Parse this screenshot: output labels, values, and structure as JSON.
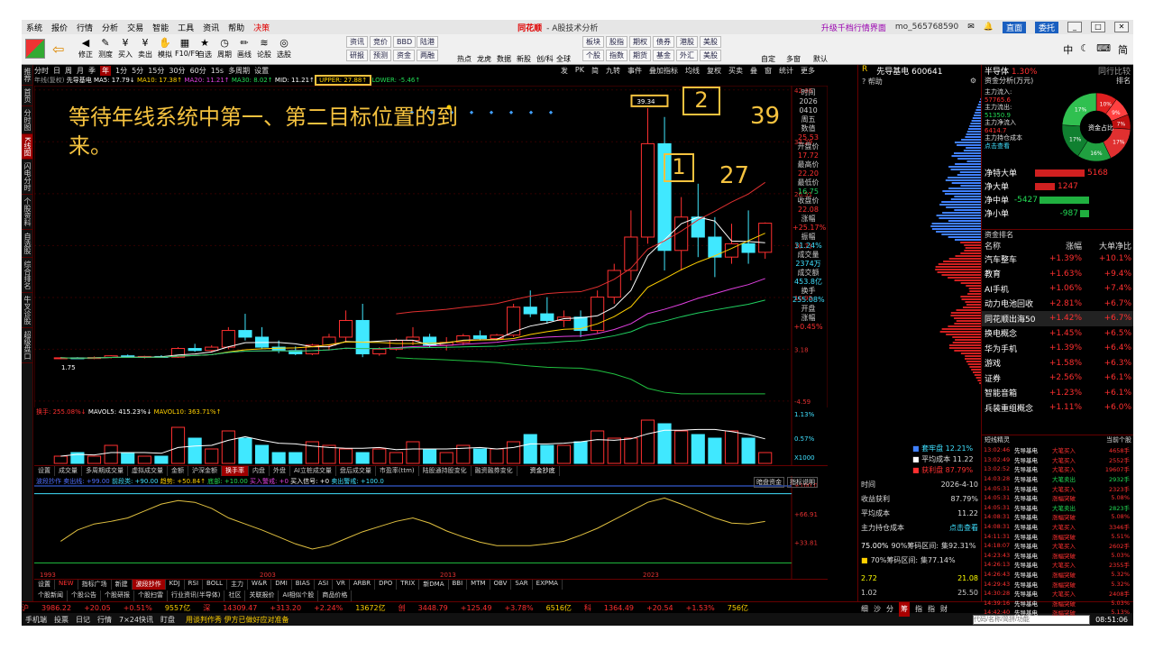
{
  "menu": [
    "系统",
    "报价",
    "行情",
    "分析",
    "交易",
    "智能",
    "工具",
    "资讯",
    "帮助",
    "决策"
  ],
  "app_title_brand": "同花顺",
  "app_title_rest": " - A股技术分析",
  "menu_right": {
    "upgrade": "升级千档行情界面",
    "user": "mo_565768590",
    "direct": "直面",
    "trade": "委托",
    "win_min": "_",
    "win_max": "□",
    "win_close": "✕"
  },
  "toolbar_buttons": [
    {
      "icon": "◀",
      "label": "修正"
    },
    {
      "icon": "✎",
      "label": "测度"
    },
    {
      "icon": "¥",
      "label": "买入"
    },
    {
      "icon": "¥",
      "label": "卖出"
    },
    {
      "icon": "✋",
      "label": "模拟"
    },
    {
      "icon": "▦",
      "label": "F10/F9"
    },
    {
      "icon": "★",
      "label": "自选"
    },
    {
      "icon": "◷",
      "label": "周期"
    },
    {
      "icon": "✏",
      "label": "画线"
    },
    {
      "icon": "≋",
      "label": "论股"
    },
    {
      "icon": "◎",
      "label": "选股"
    }
  ],
  "toolbar_groups": [
    [
      "资讯",
      "竞价",
      "BBD",
      "陆港"
    ],
    [
      "研报",
      "预测",
      "资金",
      "两融"
    ],
    [
      "板块",
      "股指",
      "期权",
      "债券",
      "港股",
      "美股"
    ],
    [
      "个股",
      "指数",
      "期货",
      "基金",
      "外汇",
      "美股"
    ]
  ],
  "toolbar_more": [
    "热点",
    "龙虎",
    "数据",
    "新股",
    "创/科",
    "全球",
    "自定",
    "多窗",
    "默认"
  ],
  "toolbar_right": [
    "中",
    "简"
  ],
  "left_strip": [
    "推荐",
    "首页",
    "分时图",
    "K线图",
    "闪电分时",
    "个股资料",
    "自选股",
    "综合排名",
    "牛叉诊股",
    "超级盘口"
  ],
  "chart_tabs": [
    "分时",
    "日",
    "周",
    "月",
    "季",
    "年",
    "1分",
    "5分",
    "15分",
    "30分",
    "60分",
    "15s",
    "多周期",
    "设置"
  ],
  "chart_tab_active": "年",
  "chart_tools": [
    "发",
    "PK",
    "简",
    "九转",
    "事件",
    "叠加指标",
    "均线",
    "复权",
    "买卖",
    "叠",
    "窗",
    "统计",
    "更多"
  ],
  "ma_legend": {
    "prefix": "年线(复权)",
    "name": "先导基电",
    "ma5": "MA5: 17.79↓",
    "ma10": "MA10: 17.38↑",
    "ma20": "MA20: 11.21↑",
    "ma30": "MA30: 8.02↑",
    "mid": "MID: 11.21↑",
    "upper": "UPPER: 27.88↑",
    "lower": "LOWER: -5.46↑"
  },
  "annotation": {
    "text": "等待年线系统中第一、第二目标位置的到来。",
    "box1": "1",
    "box2": "2",
    "num1": "27",
    "num2": "39",
    "peak": "39.34",
    "low": "1.75"
  },
  "price_axis": [
    "42.06",
    "34.29",
    "26.51",
    "18.73",
    "10.95",
    "3.18",
    "-4.59"
  ],
  "info_col": {
    "l1": "时间",
    "date": "2026",
    "md": "0410",
    "wd": "周五",
    "l2": "数值",
    "v2": "25.53",
    "l3": "开盘价",
    "v3": "17.72",
    "l4": "最高价",
    "v4": "22.20",
    "l5": "最低价",
    "v5": "16.75",
    "l6": "收盘价",
    "v6": "22.08",
    "l7": "涨幅",
    "v7": "+25.17%",
    "l8": "振幅",
    "v8": "31.24%",
    "l9": "成交量",
    "v9": "2374万",
    "l10": "成交额",
    "v10": "453.8亿",
    "l11": "换手",
    "v11": "255.08%",
    "l12": "开盘",
    "l13": "涨幅",
    "v13": "+0.45%"
  },
  "vol_legend": {
    "a": "换手: 255.08%↓",
    "b": "MAVOL5: 415.23%↓",
    "c": "MAVOL10: 363.71%↑"
  },
  "vol_axis": [
    "1.13%",
    "0.57%",
    "X1000"
  ],
  "sec_tabs": [
    "设置",
    "成交量",
    "多周期成交量",
    "虚拟成交量",
    "金额",
    "沪深金额",
    "换手率",
    "内盘",
    "外盘",
    "AI立桩成交量",
    "盘后成交量",
    "市盈率(ttm)",
    "陆股通持股变化",
    "融资融券变化"
  ],
  "sec_tab_active": "换手率",
  "sec_extra": [
    "资金抄底"
  ],
  "ind_right": [
    "暗盘资金",
    "指标说明"
  ],
  "ind_legend": {
    "name": "波段抄作",
    "a": "卖出线: +99.00",
    "b": "前段类: +90.00",
    "c": "趋势: +50.84↑",
    "d": "底部: +10.00",
    "e": "买入警戒: +0",
    "f": "买入信号: +0",
    "g": "卖出警戒: +100.0"
  },
  "ind_axis": [
    "+100.0",
    "+66.91",
    "+33.81"
  ],
  "year_axis": [
    "1993",
    "2003",
    "2013",
    "2023"
  ],
  "bot_tabs": [
    "设置",
    "NEW",
    "指标广场",
    "新建",
    "波段抄作",
    "KDJ",
    "RSI",
    "BOLL",
    "主力",
    "W&R",
    "DMI",
    "BIAS",
    "ASI",
    "VR",
    "ARBR",
    "DPO",
    "TRIX",
    "新DMA",
    "BBI",
    "MTM",
    "OBV",
    "SAR",
    "EXPMA"
  ],
  "bot_tab_active": "波段抄作",
  "news_tabs": [
    "个股新闻",
    "个股公告",
    "个股研报",
    "个股扫雷",
    "行业资讯(半导体)",
    "社区",
    "关联报价",
    "AI相似个股",
    "商品价格"
  ],
  "status": {
    "sh": "沪",
    "sh_v": "3986.22",
    "sh_c": "+20.05",
    "sh_p": "+0.51%",
    "sh_a": "9557亿",
    "sz": "深",
    "sz_v": "14309.47",
    "sz_c": "+313.20",
    "sz_p": "+2.24%",
    "sz_a": "13672亿",
    "cy": "创",
    "cy_v": "3448.79",
    "cy_c": "+125.49",
    "cy_p": "+3.78%",
    "cy_a": "6516亿",
    "kc": "科",
    "kc_v": "1364.49",
    "kc_c": "+20.54",
    "kc_p": "+1.53%",
    "kc_a": "756亿"
  },
  "footer": {
    "items": [
      "手机端",
      "投票",
      "日记",
      "行情",
      "7×24快讯",
      "盯盘"
    ],
    "ticker": "用谈判作秀 伊方已做好应对准备",
    "search_ph": "代码/名称/简拼/功能",
    "time": "08:51:06"
  },
  "stock_header": {
    "mark": "R",
    "name": "先导基电 600641",
    "help": "帮助"
  },
  "chip": {
    "legend": [
      {
        "label": "套牢盘",
        "v": "12.21%"
      },
      {
        "label": "平均成本",
        "v": "11.22"
      },
      {
        "label": "获利盘",
        "v": "87.79%"
      }
    ],
    "time_l": "时间",
    "time_v": "2026-4-10",
    "profit_l": "收益获利",
    "profit_v": "87.79%",
    "avg_l": "平均成本",
    "avg_v": "11.22",
    "hold_l": "主力持仓成本",
    "hold_v": "点击查看",
    "r90": "75.00%",
    "r90_l": "90%筹码区间:",
    "r90_v": "集92.31%",
    "r70_l": "70%筹码区间:",
    "r70_v": "集77.14%",
    "range": [
      "2.72",
      "21.08"
    ],
    "range2": [
      "1.02",
      "25.50"
    ],
    "tabs": [
      "细",
      "沙",
      "分",
      "筹",
      "指",
      "指",
      "财"
    ]
  },
  "sector_panel": {
    "name": "半导体",
    "pct": "1.30%",
    "more": "同行比较",
    "fund_title": "资金分析(万元)",
    "sort": "排名",
    "main_in_l": "主力流入:",
    "main_in": "57765.6",
    "main_out_l": "主力流出:",
    "main_out": "51350.9",
    "main_net_l": "主力净流入",
    "main_net": "6414.7",
    "hold_cost": "主力持仓成本",
    "hold_view": "点击查看",
    "donut": [
      "10%",
      "9%",
      "7%",
      "17%",
      "16%",
      "17%",
      "17%"
    ],
    "donut_center": "资金占比",
    "flows": [
      {
        "label": "净特大单",
        "v": "5168",
        "dir": "r",
        "w": 55
      },
      {
        "label": "净大单",
        "v": "1247",
        "dir": "r",
        "w": 22
      },
      {
        "label": "净中单",
        "v": "-5427",
        "dir": "g",
        "w": 55
      },
      {
        "label": "净小单",
        "v": "-987",
        "dir": "g",
        "w": 10
      }
    ]
  },
  "sector_rank": {
    "title": "资金排名",
    "headers": [
      "名称",
      "涨幅",
      "大单净比"
    ],
    "rows": [
      {
        "n": "汽车整车",
        "p": "+1.39%",
        "v": "+10.1%"
      },
      {
        "n": "教育",
        "p": "+1.63%",
        "v": "+9.4%"
      },
      {
        "n": "AI手机",
        "p": "+1.06%",
        "v": "+7.4%"
      },
      {
        "n": "动力电池回收",
        "p": "+2.81%",
        "v": "+6.7%"
      },
      {
        "n": "同花顺出海50",
        "p": "+1.42%",
        "v": "+6.7%"
      },
      {
        "n": "换电概念",
        "p": "+1.45%",
        "v": "+6.5%"
      },
      {
        "n": "华为手机",
        "p": "+1.39%",
        "v": "+6.4%"
      },
      {
        "n": "游戏",
        "p": "+1.58%",
        "v": "+6.3%"
      },
      {
        "n": "证券",
        "p": "+2.56%",
        "v": "+6.1%"
      },
      {
        "n": "智能音箱",
        "p": "+1.23%",
        "v": "+6.1%"
      },
      {
        "n": "兵装重组概念",
        "p": "+1.11%",
        "v": "+6.0%"
      }
    ]
  },
  "tick_panel": {
    "title": "短线精灵",
    "scope": "当前个股",
    "rows": [
      {
        "t": "13:02:46",
        "n": "先导基电",
        "e": "大笔买入",
        "v": "4658手",
        "c": "r"
      },
      {
        "t": "13:02:49",
        "n": "先导基电",
        "e": "大笔买入",
        "v": "2552手",
        "c": "r"
      },
      {
        "t": "13:02:52",
        "n": "先导基电",
        "e": "大笔买入",
        "v": "19607手",
        "c": "r"
      },
      {
        "t": "14:03:28",
        "n": "先导基电",
        "e": "大笔卖出",
        "v": "2932手",
        "c": "g"
      },
      {
        "t": "14:05:31",
        "n": "先导基电",
        "e": "大笔买入",
        "v": "2323手",
        "c": "r"
      },
      {
        "t": "14:05:31",
        "n": "先导基电",
        "e": "涨幅突破",
        "v": "5.08%",
        "c": "r"
      },
      {
        "t": "14:05:31",
        "n": "先导基电",
        "e": "大笔卖出",
        "v": "2823手",
        "c": "g"
      },
      {
        "t": "14:08:31",
        "n": "先导基电",
        "e": "涨幅突破",
        "v": "5.08%",
        "c": "r"
      },
      {
        "t": "14:08:31",
        "n": "先导基电",
        "e": "大笔买入",
        "v": "3346手",
        "c": "r"
      },
      {
        "t": "14:11:31",
        "n": "先导基电",
        "e": "涨幅突破",
        "v": "5.51%",
        "c": "r"
      },
      {
        "t": "14:18:07",
        "n": "先导基电",
        "e": "大笔买入",
        "v": "2602手",
        "c": "r"
      },
      {
        "t": "14:23:43",
        "n": "先导基电",
        "e": "涨幅突破",
        "v": "5.03%",
        "c": "r"
      },
      {
        "t": "14:26:13",
        "n": "先导基电",
        "e": "大笔买入",
        "v": "2355手",
        "c": "r"
      },
      {
        "t": "14:26:43",
        "n": "先导基电",
        "e": "涨幅突破",
        "v": "5.32%",
        "c": "r"
      },
      {
        "t": "14:29:43",
        "n": "先导基电",
        "e": "涨幅突破",
        "v": "5.32%",
        "c": "r"
      },
      {
        "t": "14:30:28",
        "n": "先导基电",
        "e": "大笔买入",
        "v": "2408手",
        "c": "r"
      },
      {
        "t": "14:39:16",
        "n": "先导基电",
        "e": "涨幅突破",
        "v": "5.03%",
        "c": "r"
      },
      {
        "t": "14:42:40",
        "n": "先导基电",
        "e": "涨幅突破",
        "v": "5.13%",
        "c": "r"
      }
    ]
  },
  "kline": [
    [
      1.8,
      2.0,
      1.7,
      1.9
    ],
    [
      1.9,
      2.0,
      1.75,
      1.8
    ],
    [
      1.8,
      2.1,
      1.7,
      1.95
    ],
    [
      1.95,
      2.3,
      1.8,
      2.2
    ],
    [
      2.2,
      2.4,
      1.9,
      2.0
    ],
    [
      2.0,
      2.2,
      1.8,
      2.1
    ],
    [
      2.1,
      2.3,
      1.9,
      2.0
    ],
    [
      2.0,
      3.5,
      1.9,
      3.3
    ],
    [
      3.3,
      4.0,
      2.8,
      3.0
    ],
    [
      3.0,
      3.8,
      2.7,
      3.5
    ],
    [
      3.5,
      6.5,
      3.2,
      6.0
    ],
    [
      6.0,
      8.5,
      4.5,
      5.0
    ],
    [
      5.0,
      6.5,
      3.2,
      3.5
    ],
    [
      3.5,
      4.5,
      2.6,
      3.0
    ],
    [
      3.0,
      3.6,
      2.3,
      2.5
    ],
    [
      2.5,
      4.0,
      2.3,
      3.8
    ],
    [
      3.8,
      5.5,
      3.0,
      5.0
    ],
    [
      5.0,
      9.0,
      4.2,
      7.5
    ],
    [
      7.5,
      10.0,
      2.0,
      2.5
    ],
    [
      2.5,
      3.5,
      2.2,
      3.2
    ],
    [
      3.2,
      4.8,
      3.0,
      4.5
    ],
    [
      4.5,
      6.5,
      3.8,
      5.0
    ],
    [
      5.0,
      5.5,
      3.5,
      3.8
    ],
    [
      3.8,
      5.0,
      3.0,
      4.2
    ],
    [
      4.2,
      5.5,
      3.8,
      5.2
    ],
    [
      5.2,
      6.0,
      4.5,
      4.8
    ],
    [
      4.8,
      5.5,
      4.5,
      5.3
    ],
    [
      5.3,
      10.0,
      5.0,
      9.5
    ],
    [
      9.5,
      12.0,
      8.0,
      8.5
    ],
    [
      8.5,
      11.0,
      7.0,
      7.5
    ],
    [
      7.5,
      9.0,
      6.5,
      8.0
    ],
    [
      8.0,
      9.0,
      5.0,
      6.0
    ],
    [
      6.0,
      12.0,
      5.5,
      11.0
    ],
    [
      11.0,
      16.0,
      10.0,
      15.0
    ],
    [
      15.0,
      24.0,
      13.5,
      20.0
    ],
    [
      20.0,
      39.34,
      19.0,
      34.0
    ],
    [
      34.0,
      38.0,
      15.0,
      18.0
    ],
    [
      18.0,
      26.0,
      15.0,
      23.0
    ],
    [
      23.0,
      28.0,
      17.0,
      20.0
    ],
    [
      20.0,
      23.0,
      14.0,
      17.0
    ],
    [
      17.0,
      22.0,
      16.0,
      19.0
    ],
    [
      19.0,
      24.0,
      16.0,
      17.7
    ],
    [
      17.72,
      22.2,
      16.75,
      22.08
    ]
  ],
  "volumes": [
    2,
    3,
    2,
    5,
    3,
    2,
    2,
    10,
    7,
    4,
    9,
    7,
    5,
    3,
    3,
    6,
    5,
    4,
    3,
    4,
    3,
    6,
    4,
    3,
    5,
    4,
    4,
    6,
    8,
    5,
    5,
    6,
    9,
    7,
    7,
    12,
    11,
    9,
    8,
    7,
    9,
    7,
    3
  ],
  "ind_line": [
    35,
    48,
    55,
    58,
    62,
    70,
    78,
    82,
    80,
    73,
    62,
    55,
    48,
    40,
    32,
    26,
    30,
    38,
    46,
    52,
    58,
    62,
    56,
    47,
    40,
    34,
    30,
    30,
    30,
    32,
    35,
    42,
    50,
    60,
    70,
    80,
    85,
    78,
    70,
    62,
    56,
    55,
    58
  ]
}
